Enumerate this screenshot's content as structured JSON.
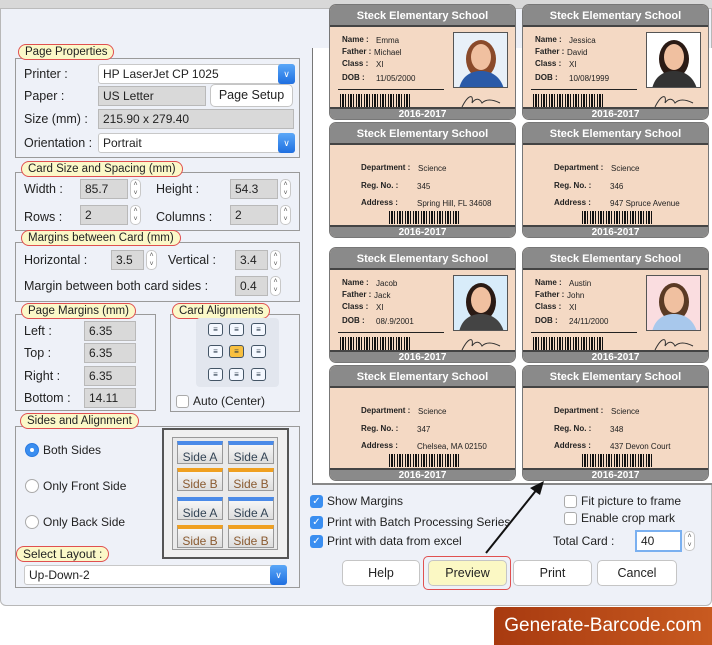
{
  "page_properties": {
    "legend": "Page Properties",
    "printer_label": "Printer :",
    "printer": "HP LaserJet CP 1025",
    "paper_label": "Paper :",
    "paper": "US Letter",
    "page_setup": "Page Setup",
    "size_label": "Size (mm) :",
    "size": "215.90 x 279.40",
    "orientation_label": "Orientation :",
    "orientation": "Portrait"
  },
  "card_size": {
    "legend": "Card Size and Spacing (mm)",
    "width_label": "Width :",
    "width": "85.7",
    "height_label": "Height :",
    "height": "54.3",
    "rows_label": "Rows :",
    "rows": "2",
    "columns_label": "Columns :",
    "columns": "2"
  },
  "margins_card": {
    "legend": "Margins between Card (mm)",
    "horizontal_label": "Horizontal :",
    "horizontal": "3.5",
    "vertical_label": "Vertical :",
    "vertical": "3.4",
    "both_label": "Margin between both card sides :",
    "both": "0.4"
  },
  "page_margins": {
    "legend": "Page Margins (mm)",
    "left_label": "Left :",
    "left": "6.35",
    "top_label": "Top :",
    "top": "6.35",
    "right_label": "Right :",
    "right": "6.35",
    "bottom_label": "Bottom :",
    "bottom": "14.11"
  },
  "card_alignments": {
    "legend": "Card Alignments",
    "selected": "middle-center",
    "auto_label": "Auto (Center)"
  },
  "sides": {
    "legend": "Sides and Alignment",
    "both": "Both Sides",
    "front": "Only Front Side",
    "back": "Only Back Side",
    "selected": "both",
    "side_a": "Side A",
    "side_b": "Side B",
    "layout_label": "Select Layout :",
    "layout": "Up-Down-2"
  },
  "options": {
    "show_margins": "Show Margins",
    "batch": "Print with Batch Processing Series",
    "excel": "Print with data from excel",
    "fit": "Fit picture to frame",
    "crop": "Enable crop mark",
    "total_label": "Total Card :",
    "total": "40"
  },
  "buttons": {
    "help": "Help",
    "preview": "Preview",
    "print": "Print",
    "cancel": "Cancel"
  },
  "watermark": "Generate-Barcode.com",
  "cards": [
    {
      "school": "Steck Elementary School",
      "year": "2016-2017",
      "type": "front",
      "name_k": "Name :",
      "name": "Emma",
      "father_k": "Father :",
      "father": "Michael",
      "class_k": "Class :",
      "class": "XI",
      "dob_k": "DOB :",
      "dob": "11/05/2000",
      "photo": "#e8f0f8",
      "hair": "#8a4a2a",
      "shirt": "#2a5aa8"
    },
    {
      "school": "Steck Elementary School",
      "year": "2016-2017",
      "type": "front",
      "name_k": "Name :",
      "name": "Jessica",
      "father_k": "Father :",
      "father": "David",
      "class_k": "Class :",
      "class": "XI",
      "dob_k": "DOB :",
      "dob": "10/08/1999",
      "photo": "#ffffff",
      "hair": "#2a1a14",
      "shirt": "#333"
    },
    {
      "school": "Steck Elementary School",
      "year": "2016-2017",
      "type": "back",
      "dept_k": "Department :",
      "dept": "Science",
      "reg_k": "Reg. No. :",
      "reg": "345",
      "addr_k": "Address :",
      "addr": "Spring Hill, FL 34608"
    },
    {
      "school": "Steck Elementary School",
      "year": "2016-2017",
      "type": "back",
      "dept_k": "Department :",
      "dept": "Science",
      "reg_k": "Reg. No. :",
      "reg": "346",
      "addr_k": "Address :",
      "addr": "947 Spruce Avenue"
    },
    {
      "school": "Steck Elementary School",
      "year": "2016-2017",
      "type": "front",
      "name_k": "Name :",
      "name": "Jacob",
      "father_k": "Father :",
      "father": "Jack",
      "class_k": "Class :",
      "class": "XI",
      "dob_k": "DOB :",
      "dob": "08/.9/2001",
      "photo": "#d8ecfa",
      "hair": "#2a1a14",
      "shirt": "#444"
    },
    {
      "school": "Steck Elementary School",
      "year": "2016-2017",
      "type": "front",
      "name_k": "Name :",
      "name": "Austin",
      "father_k": "Father :",
      "father": "John",
      "class_k": "Class :",
      "class": "XI",
      "dob_k": "DOB :",
      "dob": "24/11/2000",
      "photo": "#fadde0",
      "hair": "#5a3a24",
      "shirt": "#a8c8ec"
    },
    {
      "school": "Steck Elementary School",
      "year": "2016-2017",
      "type": "back",
      "dept_k": "Department :",
      "dept": "Science",
      "reg_k": "Reg. No. :",
      "reg": "347",
      "addr_k": "Address :",
      "addr": "Chelsea, MA 02150"
    },
    {
      "school": "Steck Elementary School",
      "year": "2016-2017",
      "type": "back",
      "dept_k": "Department :",
      "dept": "Science",
      "reg_k": "Reg. No. :",
      "reg": "348",
      "addr_k": "Address :",
      "addr": "437 Devon Court"
    }
  ]
}
